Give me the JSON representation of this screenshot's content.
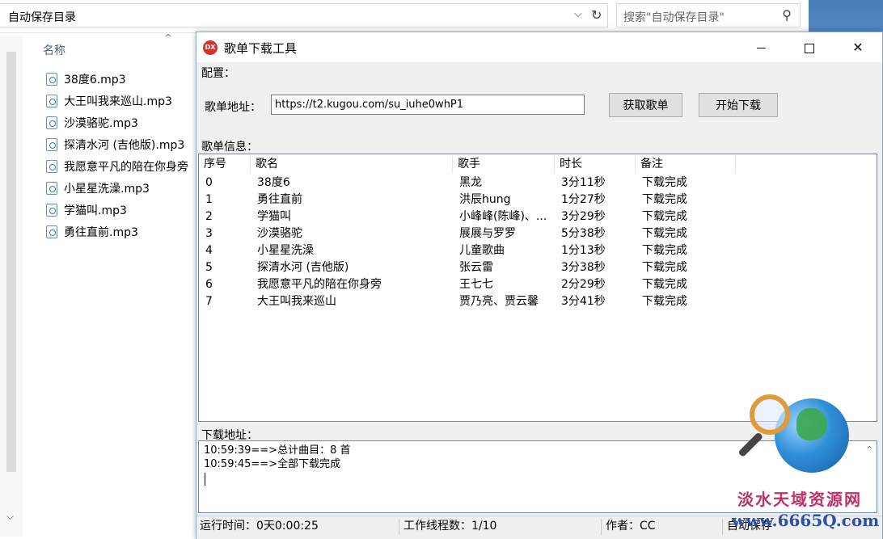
{
  "explorer": {
    "address": "自动保存目录",
    "search_placeholder": "搜索\"自动保存目录\"",
    "column_name": "名称",
    "files": [
      "38度6.mp3",
      "大王叫我来巡山.mp3",
      "沙漠骆驼.mp3",
      "探清水河 (吉他版).mp3",
      "我愿意平凡的陪在你身旁",
      "小星星洗澡.mp3",
      "学猫叫.mp3",
      "勇往直前.mp3"
    ]
  },
  "window": {
    "title": "歌单下载工具",
    "app_icon_text": "DX",
    "config_label": "配置：",
    "url_label": "歌单地址：",
    "url_value": "https://t2.kugou.com/su_iuhe0whP1",
    "fetch_button": "获取歌单",
    "start_button": "开始下载",
    "info_label": "歌单信息：",
    "table": {
      "headers": [
        "序号",
        "歌名",
        "歌手",
        "时长",
        "备注"
      ],
      "rows": [
        [
          "0",
          "38度6",
          "黑龙",
          "3分11秒",
          "下载完成"
        ],
        [
          "1",
          "勇往直前",
          "洪辰hung",
          "1分27秒",
          "下载完成"
        ],
        [
          "2",
          "学猫叫",
          "小峰峰(陈峰)、...",
          "3分29秒",
          "下载完成"
        ],
        [
          "3",
          "沙漠骆驼",
          "展展与罗罗",
          "5分38秒",
          "下载完成"
        ],
        [
          "4",
          "小星星洗澡",
          "儿童歌曲",
          "1分13秒",
          "下载完成"
        ],
        [
          "5",
          "探清水河 (吉他版)",
          "张云雷",
          "3分38秒",
          "下载完成"
        ],
        [
          "6",
          "我愿意平凡的陪在你身旁",
          "王七七",
          "2分29秒",
          "下载完成"
        ],
        [
          "7",
          "大王叫我来巡山",
          "贾乃亮、贾云馨",
          "3分41秒",
          "下载完成"
        ]
      ]
    },
    "download_label": "下载地址：",
    "log": [
      "10:59:39==>总计曲目：8 首",
      "10:59:45==>全部下载完成"
    ],
    "status": {
      "runtime": "运行时间：0天0:00:25",
      "threads": "工作线程数：1/10",
      "author": "作者：CC",
      "extra": "自动保存"
    }
  },
  "watermark": {
    "title": "淡水天域资源网",
    "url": "www.6665Q.com"
  }
}
